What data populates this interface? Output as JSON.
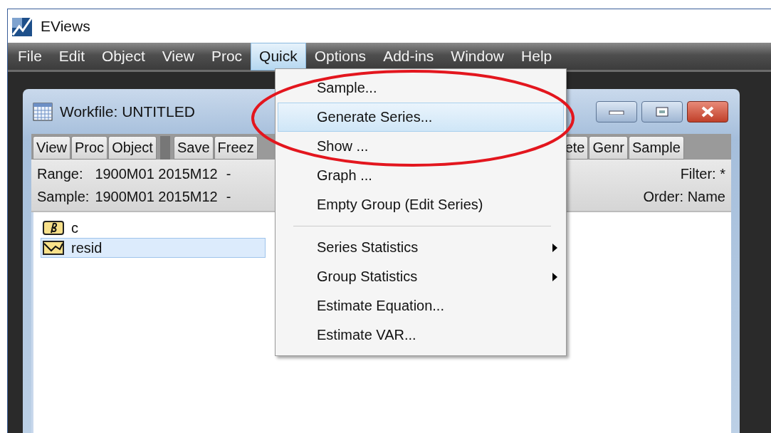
{
  "window": {
    "title": "EViews"
  },
  "menu_bar": [
    {
      "label": "File",
      "selected": false
    },
    {
      "label": "Edit",
      "selected": false
    },
    {
      "label": "Object",
      "selected": false
    },
    {
      "label": "View",
      "selected": false
    },
    {
      "label": "Proc",
      "selected": false
    },
    {
      "label": "Quick",
      "selected": true
    },
    {
      "label": "Options",
      "selected": false
    },
    {
      "label": "Add-ins",
      "selected": false
    },
    {
      "label": "Window",
      "selected": false
    },
    {
      "label": "Help",
      "selected": false
    }
  ],
  "workfile": {
    "title": "Workfile: UNTITLED",
    "toolbar_left": [
      "View",
      "Proc",
      "Object"
    ],
    "toolbar_mid": [
      "Save",
      "Freez"
    ],
    "toolbar_right": [
      "ete",
      "Genr",
      "Sample"
    ],
    "range_label": "Range:",
    "range_value": "1900M01 2015M12",
    "range_dash": "-",
    "sample_label": "Sample:",
    "sample_value": "1900M01 2015M12",
    "sample_dash": "-",
    "filter": "Filter: *",
    "order": "Order: Name",
    "objects": [
      {
        "name": "c",
        "kind": "coefficient",
        "selected": false
      },
      {
        "name": "resid",
        "kind": "series",
        "selected": true
      }
    ]
  },
  "quick_menu": [
    {
      "kind": "item",
      "label": "Sample...",
      "selected": false,
      "submenu": false
    },
    {
      "kind": "item",
      "label": "Generate Series...",
      "selected": true,
      "submenu": false
    },
    {
      "kind": "item",
      "label": "Show ...",
      "selected": false,
      "submenu": false
    },
    {
      "kind": "item",
      "label": "Graph ...",
      "selected": false,
      "submenu": false
    },
    {
      "kind": "item",
      "label": "Empty Group (Edit Series)",
      "selected": false,
      "submenu": false
    },
    {
      "kind": "separator"
    },
    {
      "kind": "item",
      "label": "Series Statistics",
      "selected": false,
      "submenu": true
    },
    {
      "kind": "item",
      "label": "Group Statistics",
      "selected": false,
      "submenu": true
    },
    {
      "kind": "item",
      "label": "Estimate Equation...",
      "selected": false,
      "submenu": false
    },
    {
      "kind": "item",
      "label": "Estimate VAR...",
      "selected": false,
      "submenu": false
    }
  ]
}
